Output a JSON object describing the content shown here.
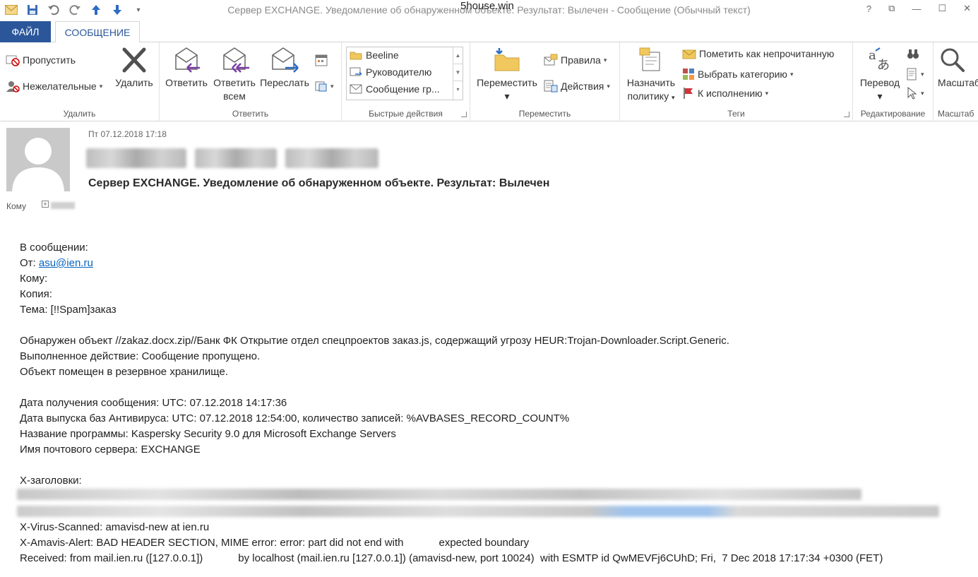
{
  "window": {
    "title": "Сервер EXCHANGE. Уведомление об обнаруженном объекте. Результат: Вылечен - Сообщение (Обычный текст)",
    "watermark": "5house.win",
    "help": "?",
    "restore_ribbon": "⧉",
    "minimize": "—",
    "maximize": "☐",
    "close": "✕"
  },
  "tabs": {
    "file": "ФАЙЛ",
    "message": "СООБЩЕНИЕ"
  },
  "ribbon": {
    "delete_group": {
      "label": "Удалить",
      "ignore": "Пропустить",
      "junk": "Нежелательные",
      "delete": "Удалить"
    },
    "respond_group": {
      "label": "Ответить",
      "reply": "Ответить",
      "reply_all_1": "Ответить",
      "reply_all_2": "всем",
      "forward": "Переслать"
    },
    "quick_steps": {
      "label": "Быстрые действия",
      "items": [
        "Beeline",
        "Руководителю",
        "Сообщение гр..."
      ]
    },
    "move_group": {
      "label": "Переместить",
      "move": "Переместить",
      "rules": "Правила",
      "actions": "Действия"
    },
    "tags_group": {
      "label": "Теги",
      "assign_policy_1": "Назначить",
      "assign_policy_2": "политику",
      "mark_unread": "Пометить как непрочитанную",
      "categorize": "Выбрать категорию",
      "follow_up": "К исполнению"
    },
    "editing_group": {
      "label": "Редактирование",
      "translate": "Перевод"
    },
    "zoom_group": {
      "label": "Масштаб",
      "zoom": "Масштаб"
    }
  },
  "message": {
    "sent": "Пт 07.12.2018 17:18",
    "subject": "Сервер EXCHANGE. Уведомление об обнаруженном объекте. Результат: Вылечен",
    "to_label": "Кому",
    "body": {
      "l1": "В сообщении:",
      "from_label": "От: ",
      "from_email": "asu@ien.ru",
      "l3": "Кому:",
      "l4": "Копия:",
      "l5": "Тема: [!!Spam]заказ",
      "l6": "Обнаружен объект //zakaz.docx.zip//Банк ФК Открытие отдел спецпроектов заказ.js, содержащий угрозу HEUR:Trojan-Downloader.Script.Generic.",
      "l7": "Выполненное действие: Сообщение пропущено.",
      "l8": "Объект помещен в резервное хранилище.",
      "l9": "Дата получения сообщения: UTC: 07.12.2018 14:17:36",
      "l10": "Дата выпуска баз Антивируса: UTC: 07.12.2018 12:54:00, количество записей: %AVBASES_RECORD_COUNT%",
      "l11": "Название программы: Kaspersky Security 9.0 для Microsoft Exchange Servers",
      "l12": "Имя почтового сервера: EXCHANGE",
      "l13": "X-заголовки:",
      "l14": "X-Virus-Scanned: amavisd-new at ien.ru",
      "l15": "X-Amavis-Alert: BAD HEADER SECTION, MIME error: error: part did not end with            expected boundary",
      "l16": "Received: from mail.ien.ru ([127.0.0.1])            by localhost (mail.ien.ru [127.0.0.1]) (amavisd-new, port 10024)  with ESMTP id QwMEVFj6CUhD; Fri,  7 Dec 2018 17:17:34 +0300 (FET)"
    }
  },
  "colors": {
    "accent": "#2b579a",
    "link": "#0563c1",
    "flag": "#d13438"
  }
}
